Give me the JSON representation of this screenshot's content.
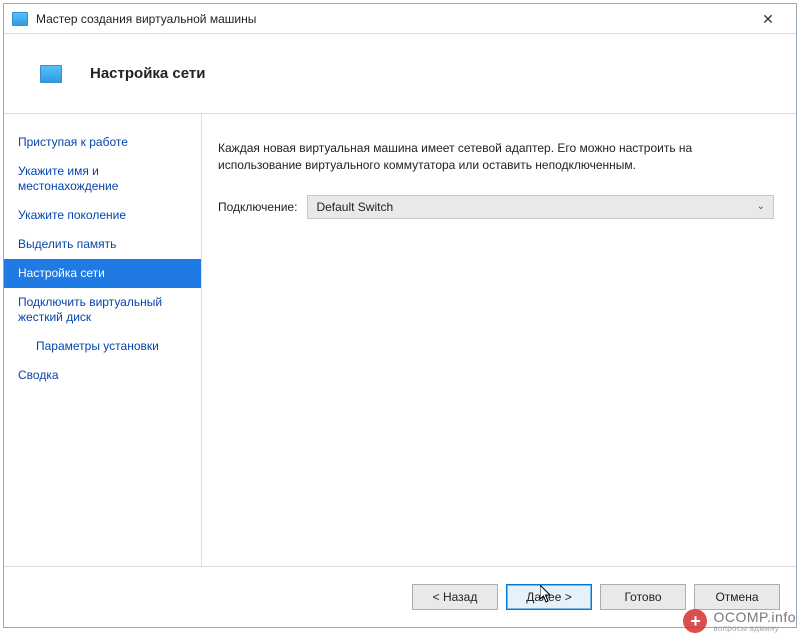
{
  "titlebar": {
    "title": "Мастер создания виртуальной машины",
    "close": "✕"
  },
  "header": {
    "title": "Настройка сети"
  },
  "sidebar": {
    "items": [
      {
        "label": "Приступая к работе"
      },
      {
        "label": "Укажите имя и местонахождение"
      },
      {
        "label": "Укажите поколение"
      },
      {
        "label": "Выделить память"
      },
      {
        "label": "Настройка сети"
      },
      {
        "label": "Подключить виртуальный жесткий диск"
      },
      {
        "label": "Параметры установки"
      },
      {
        "label": "Сводка"
      }
    ]
  },
  "content": {
    "description": "Каждая новая виртуальная машина имеет сетевой адаптер. Его можно настроить на использование виртуального коммутатора или оставить неподключенным.",
    "connectionLabel": "Подключение:",
    "connectionValue": "Default Switch"
  },
  "footer": {
    "back": "< Назад",
    "next": "Далее >",
    "finish": "Готово",
    "cancel": "Отмена"
  },
  "watermark": {
    "main": "OCOMP.info",
    "sub": "вопросы админу"
  }
}
